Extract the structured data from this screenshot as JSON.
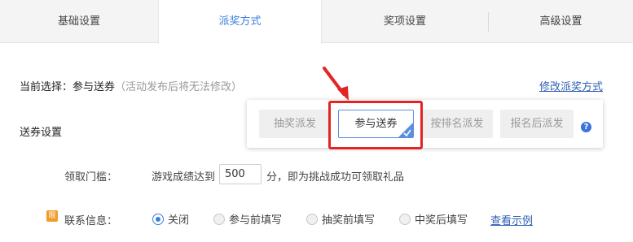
{
  "tabs": [
    {
      "label": "基础设置"
    },
    {
      "label": "派奖方式"
    },
    {
      "label": "奖项设置"
    },
    {
      "label": "高级设置"
    }
  ],
  "current": {
    "prefix": "当前选择：参与送券",
    "hint": "（活动发布后将无法修改）",
    "modify_link": "修改派奖方式"
  },
  "popover": {
    "options": [
      "抽奖派发",
      "参与送券",
      "按排名派发",
      "报名后派发"
    ],
    "selected": "参与送券",
    "help": "?"
  },
  "section": {
    "title": "送券设置"
  },
  "threshold": {
    "label": "领取门槛：",
    "text_before": "游戏成绩达到",
    "value": "500",
    "text_after": "分，即为挑战成功可领取礼品"
  },
  "contact": {
    "icon_text": "限",
    "label": "联系信息：",
    "options": [
      "关闭",
      "参与前填写",
      "抽奖前填写",
      "中奖后填写"
    ],
    "selected": "关闭",
    "example_link": "查看示例"
  },
  "colors": {
    "accent": "#3b7fdb",
    "highlight": "#e32424",
    "link": "#2f5fb3",
    "badge": "#f39a29"
  }
}
